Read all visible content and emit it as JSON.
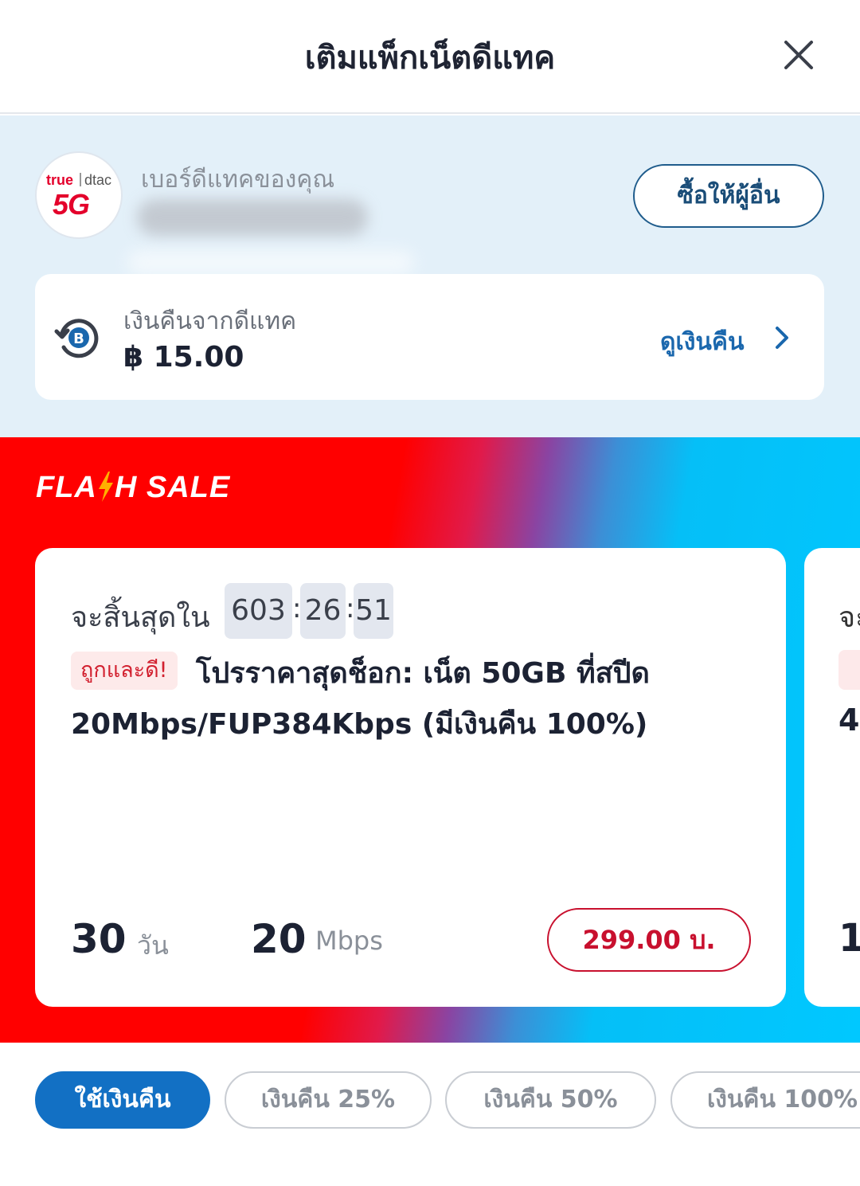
{
  "header": {
    "title": "เติมแพ็กเน็ตดีแทค",
    "close_icon": "close-icon"
  },
  "account": {
    "logo": {
      "true_text": "true",
      "dtac_text": "dtac",
      "five_g_text": "5G"
    },
    "number_label": "เบอร์ดีแทคของคุณ",
    "gift_button": "ซื้อให้ผู้อื่น"
  },
  "cashback": {
    "label": "เงินคืนจากดีแทค",
    "amount": "฿ 15.00",
    "link": "ดูเงินคืน",
    "icon": "cashback-refresh-icon"
  },
  "flash_sale": {
    "title_part1": "FLA",
    "title_part2": "H SALE",
    "card": {
      "expire_label": "จะสิ้นสุดใน",
      "timer": {
        "hours": "603",
        "minutes": "26",
        "seconds": "51",
        "sep": ":"
      },
      "badge": "ถูกและดี!",
      "title_line1": "โปรราคาสุดช็อก: เน็ต 50GB ที่สปีด",
      "title_line2": "20Mbps/FUP384Kbps (มีเงินคืน 100%)",
      "days_value": "30",
      "days_unit": "วัน",
      "speed_value": "20",
      "speed_unit": "Mbps",
      "price": "299.00 บ."
    },
    "peek_card": {
      "char1": "จะ",
      "char2": "4",
      "char3": "1"
    }
  },
  "colors": {
    "primary_blue": "#1270c4",
    "flash_red": "#ff0000",
    "flash_cyan": "#00c8ff",
    "price_red": "#c8102e"
  },
  "filters": [
    {
      "label": "ใช้เงินคืน",
      "active": true
    },
    {
      "label": "เงินคืน 25%",
      "active": false
    },
    {
      "label": "เงินคืน 50%",
      "active": false
    },
    {
      "label": "เงินคืน 100%",
      "active": false
    }
  ]
}
